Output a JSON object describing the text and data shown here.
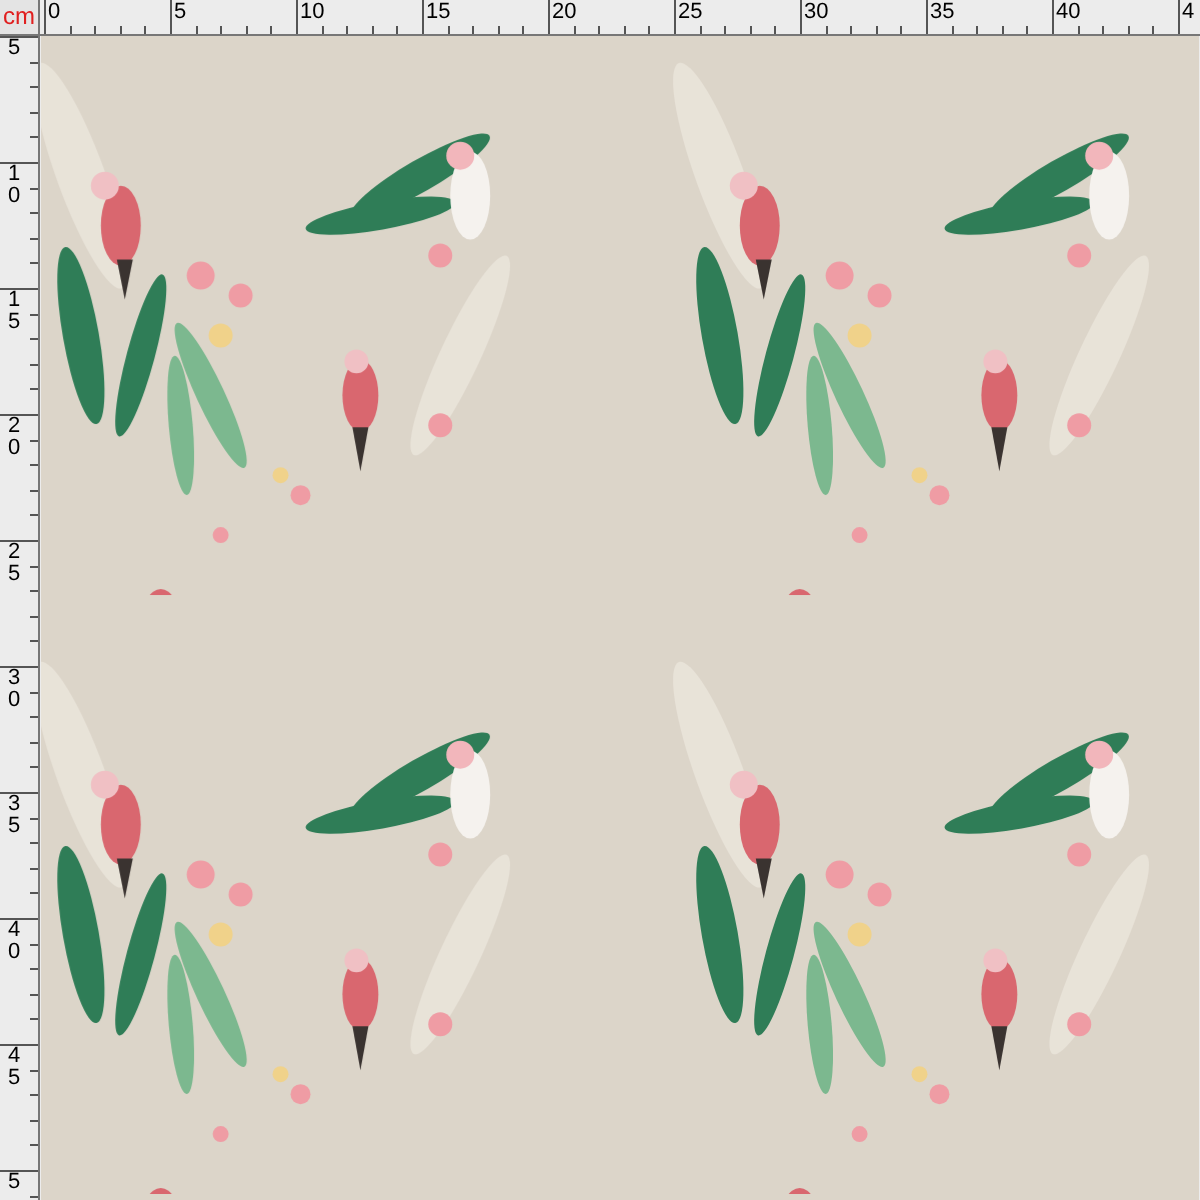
{
  "ruler": {
    "unit": "cm",
    "top_labels": [
      "0",
      "5",
      "10",
      "15",
      "20",
      "25",
      "30",
      "35",
      "40",
      "4"
    ],
    "left_labels": [
      "5",
      "10",
      "15",
      "20",
      "25",
      "30",
      "35",
      "40",
      "45",
      "5"
    ]
  }
}
